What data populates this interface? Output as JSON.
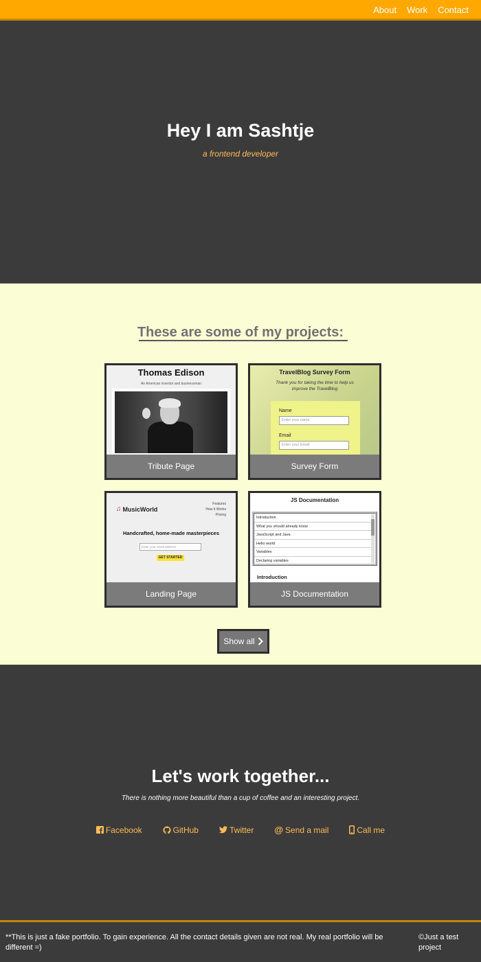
{
  "navbar": {
    "links": [
      "About",
      "Work",
      "Contact"
    ]
  },
  "hero": {
    "title": "Hey I am Sashtje",
    "subtitle": "a frontend developer"
  },
  "projects": {
    "title": "These are some of my projects:",
    "cards": [
      {
        "label": "Tribute Page"
      },
      {
        "label": "Survey Form"
      },
      {
        "label": "Landing Page"
      },
      {
        "label": "JS Documentation"
      }
    ],
    "show_all": "Show all",
    "tribute_preview": {
      "title": "Thomas Edison",
      "subtitle": "An American inventor and businessman"
    },
    "survey_preview": {
      "title": "TravelBlog Survey Form",
      "text": "Thank you for taking the time to help us improve the TravelBlog",
      "name_label": "Name",
      "name_placeholder": "Enter your name",
      "email_label": "Email",
      "email_placeholder": "Enter your Email"
    },
    "landing_preview": {
      "logo": "MusicWorld",
      "nav": [
        "Features",
        "How It Works",
        "Pricing"
      ],
      "heading": "Handcrafted, home-made masterpieces",
      "email_placeholder": "Enter your email address",
      "button": "GET STARTED"
    },
    "jsdoc_preview": {
      "title": "JS Documentation",
      "items": [
        "Introduction",
        "What you should already know",
        "JavaScript and Java",
        "Hello world",
        "Variables",
        "Declaring variables"
      ],
      "section": "Introduction"
    }
  },
  "contact": {
    "title": "Let's work together...",
    "text": "There is nothing more beautiful than a cup of coffee and an interesting project.",
    "links": [
      {
        "label": "Facebook",
        "icon": "facebook-icon"
      },
      {
        "label": "GitHub",
        "icon": "github-icon"
      },
      {
        "label": "Twitter",
        "icon": "twitter-icon"
      },
      {
        "label": "Send a mail",
        "icon": "at-icon"
      },
      {
        "label": "Call me",
        "icon": "mobile-icon"
      }
    ]
  },
  "footer": {
    "note": "**This is just a fake portfolio. To gain experience. All the contact details given are not real. My real portfolio will be different =)",
    "copyright": "©Just a test project"
  },
  "colors": {
    "navbar": "#ffa800",
    "dark_bg": "#3b3b3b",
    "projects_bg": "#fbfed5",
    "accent_text": "#ffbb55",
    "card_label_bg": "#7b7b7b"
  }
}
